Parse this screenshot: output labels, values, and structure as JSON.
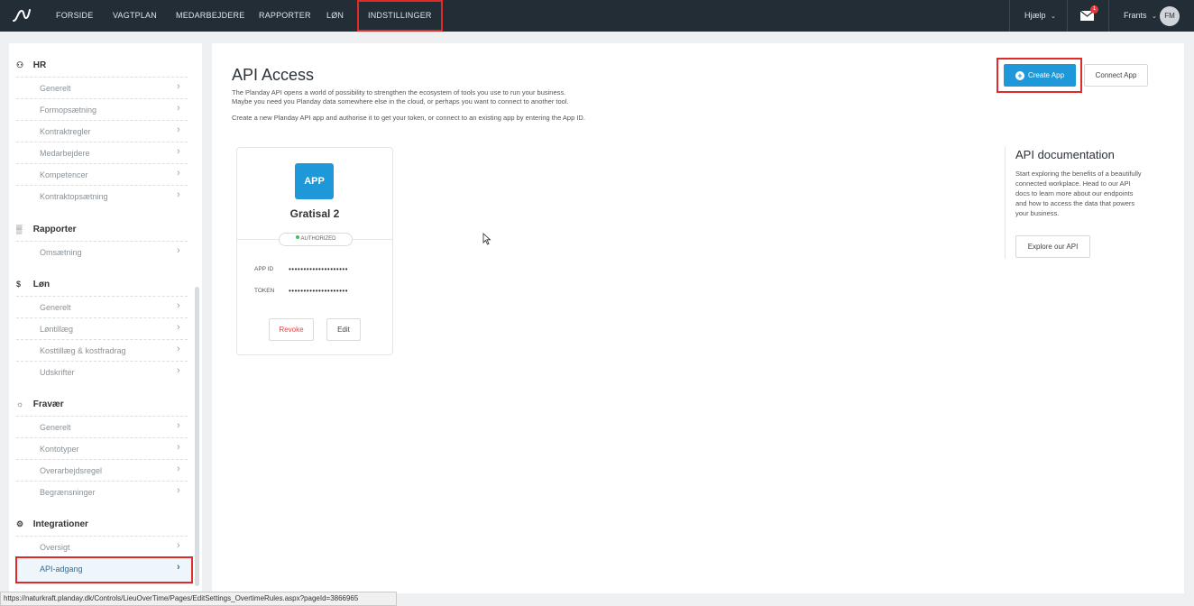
{
  "nav": {
    "items": [
      "FORSIDE",
      "VAGTPLAN",
      "MEDARBEJDERE",
      "RAPPORTER",
      "LØN",
      "INDSTILLINGER"
    ],
    "help": "Hjælp",
    "mail_badge": "1",
    "user_name": "Frants",
    "user_initials": "FM"
  },
  "sidebar": {
    "hr": {
      "title": "HR",
      "items": [
        "Generelt",
        "Formopsætning",
        "Kontraktregler",
        "Medarbejdere",
        "Kompetencer",
        "Kontraktopsætning"
      ]
    },
    "rapporter": {
      "title": "Rapporter",
      "items": [
        "Omsætning"
      ]
    },
    "lon": {
      "title": "Løn",
      "items": [
        "Generelt",
        "Løntillæg",
        "Kosttillæg & kostfradrag",
        "Udskrifter"
      ]
    },
    "fravaer": {
      "title": "Fravær",
      "items": [
        "Generelt",
        "Kontotyper",
        "Overarbejdsregel",
        "Begrænsninger"
      ]
    },
    "integrationer": {
      "title": "Integrationer",
      "items": [
        "Oversigt",
        "API-adgang"
      ]
    }
  },
  "main": {
    "title": "API Access",
    "desc1": "The Planday API opens a world of possibility to strengthen the ecosystem of tools you use to run your business.",
    "desc2": "Maybe you need you Planday data somewhere else in the cloud, or perhaps you want to connect to another tool.",
    "desc3": "Create a new Planday API app and authorise it to get your token, or connect to an existing app by entering the App ID.",
    "create_label": "Create App",
    "connect_label": "Connect App",
    "app": {
      "tile": "APP",
      "name": "Gratisal 2",
      "status": "AUTHORIZED",
      "app_id_label": "APP ID",
      "app_id_value": "••••••••••••••••••••",
      "token_label": "TOKEN",
      "token_value": "••••••••••••••••••••",
      "revoke_label": "Revoke",
      "edit_label": "Edit"
    },
    "doc": {
      "title": "API documentation",
      "text": "Start exploring the benefits of a beautifully connected workplace. Head to our API docs to learn more about our endpoints and how to access the data that powers your business.",
      "explore_label": "Explore our API"
    }
  },
  "status_url": "https://naturkraft.planday.dk/Controls/LieuOverTime/Pages/EditSettings_OvertimeRules.aspx?pageId=3866965",
  "colors": {
    "topbar": "#232d36",
    "accent": "#1e98d8",
    "highlight": "#e02b2b",
    "authorized": "#3fbf5f"
  },
  "icons": [
    "planday-logo-icon",
    "people-icon",
    "bar-chart-icon",
    "dollar-icon",
    "sun-icon",
    "gear-icon",
    "chevron-right-icon",
    "chevron-down-icon",
    "mail-icon",
    "plus-circle-icon",
    "mouse-cursor-icon"
  ]
}
